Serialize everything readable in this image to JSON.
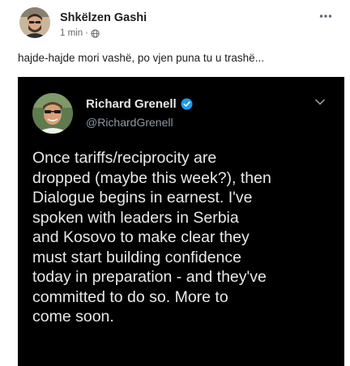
{
  "post": {
    "author": "Shkëlzen Gashi",
    "time": "1 min",
    "separator": "·",
    "privacy_icon": "globe-icon",
    "more_icon": "more-horizontal-icon",
    "caption": "hajde-hajde mori vashë, po vjen puna tu u trashë..."
  },
  "tweet": {
    "name": "Richard Grenell",
    "verified_icon": "verified-badge-icon",
    "handle": "@RichardGrenell",
    "menu_icon": "chevron-down-icon",
    "text": "Once tariffs/reciprocity are\ndropped (maybe this week?), then\nDialogue begins in earnest. I've\nspoken with leaders in Serbia\nand Kosovo to make clear they\nmust start building confidence\ntoday in preparation - and they've\ncommitted to do so. More to\ncome soon."
  },
  "colors": {
    "tweet_background": "#000000",
    "tweet_text": "#e7e9ea",
    "handle_text": "#8b98a5",
    "verified_blue": "#1d9bf0",
    "meta_text": "#65676b"
  }
}
